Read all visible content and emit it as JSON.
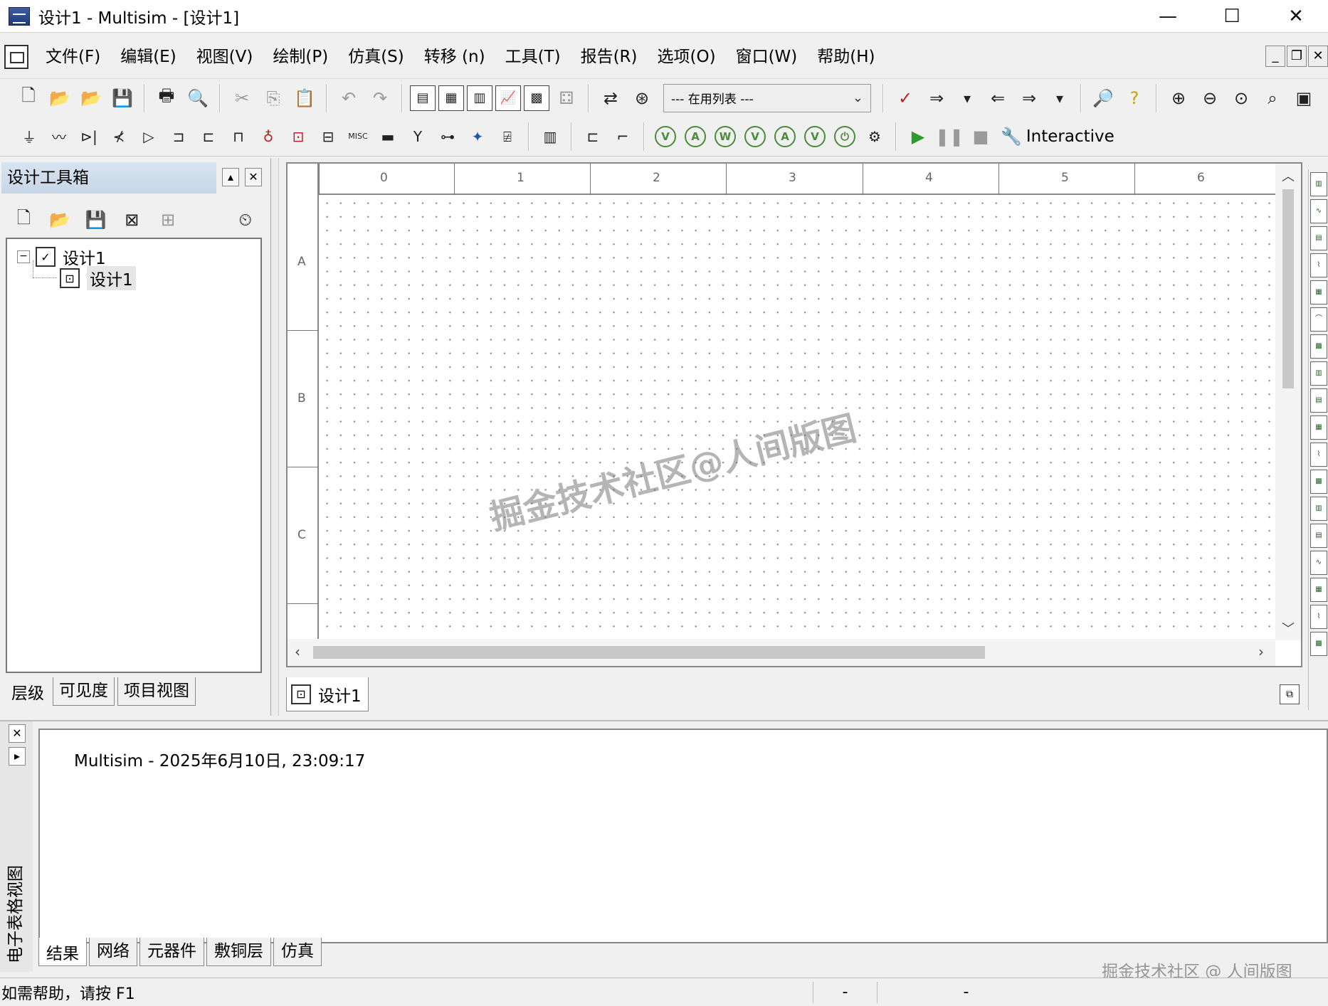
{
  "window": {
    "title": "设计1 - Multisim - [设计1]",
    "controls": [
      "—",
      "☐",
      "✕"
    ],
    "mdi_controls": [
      "_",
      "❐",
      "✕"
    ]
  },
  "menu": [
    "文件(F)",
    "编辑(E)",
    "视图(V)",
    "绘制(P)",
    "仿真(S)",
    "转移 (n)",
    "工具(T)",
    "报告(R)",
    "选项(O)",
    "窗口(W)",
    "帮助(H)"
  ],
  "toolbar": {
    "in_use_list": "--- 在用列表 ---",
    "interactive_label": "Interactive",
    "misc_label": "MISC"
  },
  "toolbox": {
    "title": "设计工具箱",
    "tree": {
      "root": "设计1",
      "child": "设计1"
    },
    "tabs": [
      "层级",
      "可见度",
      "项目视图"
    ]
  },
  "canvas": {
    "col_labels": [
      "0",
      "1",
      "2",
      "3",
      "4",
      "5",
      "6"
    ],
    "row_labels": [
      "A",
      "B",
      "C"
    ],
    "tab_label": "设计1",
    "watermark": "掘金技术社区@人间版图"
  },
  "spreadsheet": {
    "side_label": "电子表格视图",
    "log": "Multisim  -  2025年6月10日, 23:09:17",
    "tabs": [
      "结果",
      "网络",
      "元器件",
      "敷铜层",
      "仿真"
    ]
  },
  "status": {
    "help": "如需帮助，请按 F1",
    "cell1": "-",
    "cell2": "-",
    "watermark": "掘金技术社区 @ 人间版图"
  },
  "colors": {
    "grid_dot": "#8a8a8a",
    "play_green": "#2f9a2f",
    "instrument_green": "#4c8a3c",
    "header_blue": "#c7d6e6"
  },
  "icons": {
    "toolbar1": [
      "new-file-icon",
      "open-icon",
      "open-folder-icon",
      "save-icon",
      "print-icon",
      "print-preview-icon",
      "cut-icon",
      "copy-icon",
      "paste-icon",
      "undo-icon",
      "redo-icon"
    ],
    "toolbar2_places": [
      "source",
      "basic",
      "diode",
      "transistor",
      "analog",
      "ttl",
      "cmos",
      "mcu",
      "indicator",
      "power",
      "misc"
    ]
  }
}
